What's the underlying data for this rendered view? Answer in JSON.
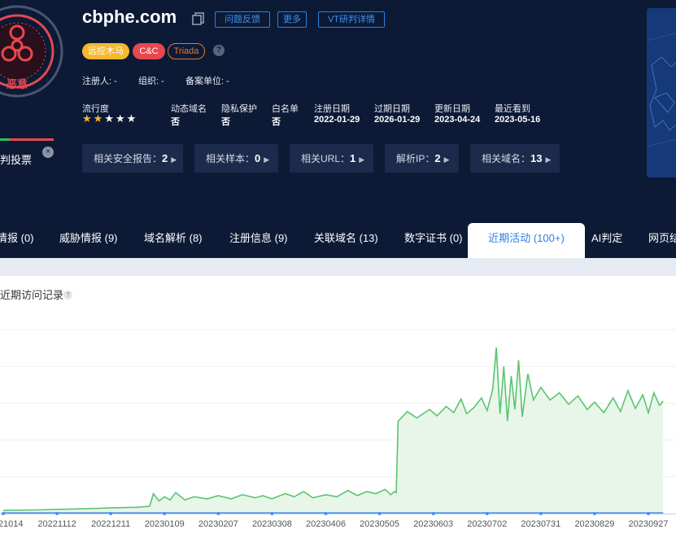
{
  "domain": {
    "name": "cbphe.com",
    "verdict": "恶意",
    "seal_text": "威胁情报中心",
    "feedback_label": "问题反馈",
    "more_label": "更多",
    "vt_label": "VT研判详情",
    "tags": [
      {
        "label": "远控木马",
        "color": "#f5b82e"
      },
      {
        "label": "C&C",
        "color": "#e7484e"
      },
      {
        "label": "Triada",
        "color": "#e07a2d"
      }
    ],
    "help": "?"
  },
  "registration": {
    "registrant": "注册人: -",
    "org": "组织: -",
    "filing": "备案单位: -"
  },
  "stats": {
    "popularity_label": "流行度",
    "popularity_stars": 2,
    "popularity_max": 5,
    "items": [
      {
        "label": "动态域名",
        "value": "否"
      },
      {
        "label": "隐私保护",
        "value": "否"
      },
      {
        "label": "白名单",
        "value": "否"
      },
      {
        "label": "注册日期",
        "value": "2022-01-29"
      },
      {
        "label": "过期日期",
        "value": "2026-01-29"
      },
      {
        "label": "更新日期",
        "value": "2023-04-24"
      },
      {
        "label": "最近看到",
        "value": "2023-05-16"
      }
    ]
  },
  "vote": {
    "label": "判投票",
    "close": "×",
    "good_ratio": 0.18
  },
  "related": [
    {
      "label": "相关安全报告：",
      "count": "2"
    },
    {
      "label": "相关样本：",
      "count": "0"
    },
    {
      "label": "相关URL：",
      "count": "1"
    },
    {
      "label": "解析IP：",
      "count": "2"
    },
    {
      "label": "相关域名：",
      "count": "13"
    }
  ],
  "tabs": [
    {
      "label": "情报 (0)"
    },
    {
      "label": "威胁情报 (9)"
    },
    {
      "label": "域名解析 (8)"
    },
    {
      "label": "注册信息 (9)"
    },
    {
      "label": "关联域名 (13)"
    },
    {
      "label": "数字证书 (0)"
    },
    {
      "label": "近期活动 (100+)",
      "active": true
    },
    {
      "label": "AI判定"
    },
    {
      "label": "网页结"
    }
  ],
  "chart_section": {
    "title": "近期访问记录",
    "help": "?"
  },
  "chart_data": {
    "type": "line",
    "title": "近期访问记录",
    "xlabel": "",
    "ylabel": "",
    "x_ticks": [
      "20221014",
      "20221112",
      "20221211",
      "20230109",
      "20230207",
      "20230308",
      "20230406",
      "20230505",
      "20230603",
      "20230702",
      "20230731",
      "20230829",
      "20230927"
    ],
    "x_range": [
      "2022-10-14",
      "2023-10-05"
    ],
    "y_ticks_visible": false,
    "grid": true,
    "series": [
      {
        "color": "#5cc46f",
        "fill": true,
        "points": [
          [
            "2022-10-14",
            3
          ],
          [
            "2022-11-01",
            3.5
          ],
          [
            "2022-11-12",
            4
          ],
          [
            "2022-11-25",
            4.5
          ],
          [
            "2022-12-05",
            5
          ],
          [
            "2022-12-11",
            5.5
          ],
          [
            "2022-12-25",
            6
          ],
          [
            "2023-01-01",
            7
          ],
          [
            "2023-01-03",
            19
          ],
          [
            "2023-01-06",
            12
          ],
          [
            "2023-01-09",
            16
          ],
          [
            "2023-01-12",
            13
          ],
          [
            "2023-01-15",
            20
          ],
          [
            "2023-01-20",
            13
          ],
          [
            "2023-01-25",
            16
          ],
          [
            "2023-02-01",
            14
          ],
          [
            "2023-02-07",
            17
          ],
          [
            "2023-02-14",
            14
          ],
          [
            "2023-02-20",
            18
          ],
          [
            "2023-02-27",
            15
          ],
          [
            "2023-03-03",
            17
          ],
          [
            "2023-03-08",
            14
          ],
          [
            "2023-03-15",
            19
          ],
          [
            "2023-03-20",
            16
          ],
          [
            "2023-03-25",
            21
          ],
          [
            "2023-03-30",
            15
          ],
          [
            "2023-04-06",
            18
          ],
          [
            "2023-04-12",
            16
          ],
          [
            "2023-04-18",
            22
          ],
          [
            "2023-04-23",
            17
          ],
          [
            "2023-04-28",
            21
          ],
          [
            "2023-05-03",
            19
          ],
          [
            "2023-05-08",
            23
          ],
          [
            "2023-05-11",
            18
          ],
          [
            "2023-05-13",
            21
          ],
          [
            "2023-05-14",
            20
          ],
          [
            "2023-05-15",
            88
          ],
          [
            "2023-05-20",
            97
          ],
          [
            "2023-05-25",
            91
          ],
          [
            "2023-06-01",
            99
          ],
          [
            "2023-06-05",
            93
          ],
          [
            "2023-06-10",
            102
          ],
          [
            "2023-06-14",
            96
          ],
          [
            "2023-06-18",
            109
          ],
          [
            "2023-06-21",
            95
          ],
          [
            "2023-06-25",
            101
          ],
          [
            "2023-06-29",
            110
          ],
          [
            "2023-07-02",
            98
          ],
          [
            "2023-07-05",
            118
          ],
          [
            "2023-07-07",
            158
          ],
          [
            "2023-07-09",
            95
          ],
          [
            "2023-07-11",
            140
          ],
          [
            "2023-07-13",
            88
          ],
          [
            "2023-07-15",
            131
          ],
          [
            "2023-07-17",
            99
          ],
          [
            "2023-07-19",
            146
          ],
          [
            "2023-07-21",
            92
          ],
          [
            "2023-07-24",
            133
          ],
          [
            "2023-07-27",
            108
          ],
          [
            "2023-07-31",
            120
          ],
          [
            "2023-08-05",
            108
          ],
          [
            "2023-08-10",
            115
          ],
          [
            "2023-08-15",
            104
          ],
          [
            "2023-08-20",
            112
          ],
          [
            "2023-08-25",
            99
          ],
          [
            "2023-08-29",
            106
          ],
          [
            "2023-09-03",
            96
          ],
          [
            "2023-09-08",
            110
          ],
          [
            "2023-09-12",
            97
          ],
          [
            "2023-09-16",
            117
          ],
          [
            "2023-09-20",
            100
          ],
          [
            "2023-09-24",
            113
          ],
          [
            "2023-09-27",
            96
          ],
          [
            "2023-09-30",
            115
          ],
          [
            "2023-10-03",
            103
          ],
          [
            "2023-10-05",
            107
          ]
        ]
      },
      {
        "color": "#4a8ff0",
        "fill": false,
        "points": [
          [
            "2022-10-14",
            0.5
          ],
          [
            "2023-10-05",
            0.5
          ]
        ]
      }
    ],
    "y_range": [
      0,
      175
    ]
  }
}
